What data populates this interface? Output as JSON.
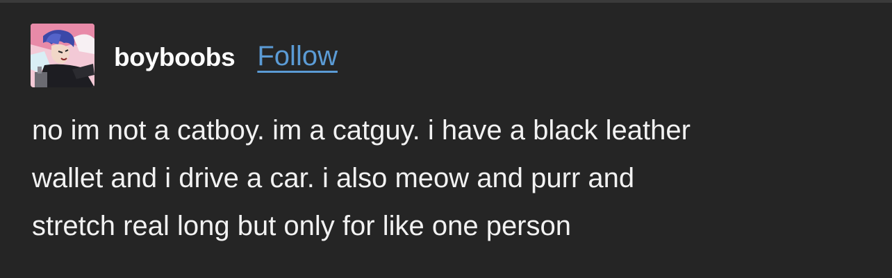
{
  "post": {
    "username": "boyboobs",
    "follow_label": "Follow",
    "avatar_icon": "anime-character-avatar",
    "body_lines": [
      "no im not a catboy. im a catguy. i have a black leather",
      "wallet and i drive a car. i also meow and purr and",
      "stretch real long but only for like one person"
    ]
  },
  "colors": {
    "background": "#252525",
    "text": "#f2f2f2",
    "link": "#5b9bd5"
  }
}
